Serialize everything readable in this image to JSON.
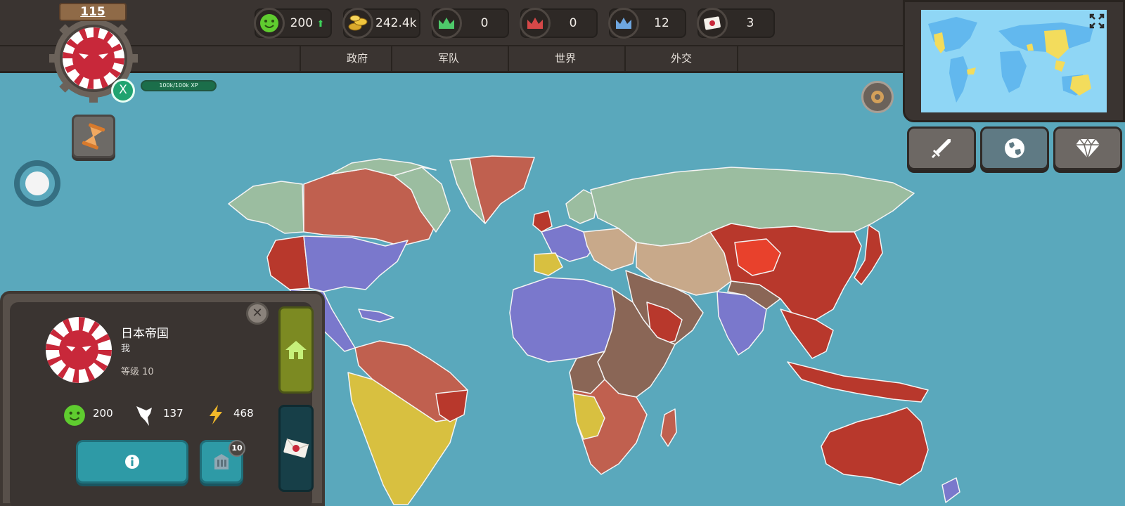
{
  "player": {
    "level": "115",
    "xp_button": "X",
    "xp_text": "100k/100k XP"
  },
  "resources": [
    {
      "icon": "smiley-icon",
      "value": "200",
      "trend": "up"
    },
    {
      "icon": "gold-coins-icon",
      "value": "242.4k",
      "trend": "up"
    },
    {
      "icon": "green-crown-icon",
      "value": "0"
    },
    {
      "icon": "red-crown-icon",
      "value": "0"
    },
    {
      "icon": "blue-crown-icon",
      "value": "12"
    },
    {
      "icon": "letter-icon",
      "value": "3"
    }
  ],
  "tabs": [
    "政府",
    "军队",
    "世界",
    "外交"
  ],
  "country": {
    "name": "日本帝国",
    "owner": "我",
    "level": "等级 10",
    "stats": [
      {
        "icon": "smiley-icon",
        "value": "200"
      },
      {
        "icon": "dove-icon",
        "value": "137"
      },
      {
        "icon": "lightning-icon",
        "value": "468"
      }
    ],
    "build_badge": "10"
  },
  "colors": {
    "ocean": "#5aa8bc",
    "player_red": "#b8382c",
    "neutral_green": "#9bbda0",
    "blue_bloc": "#7a78cc",
    "yellow_bloc": "#d8c040",
    "brown_bloc": "#8a6656",
    "tan_bloc": "#c8a98a"
  }
}
